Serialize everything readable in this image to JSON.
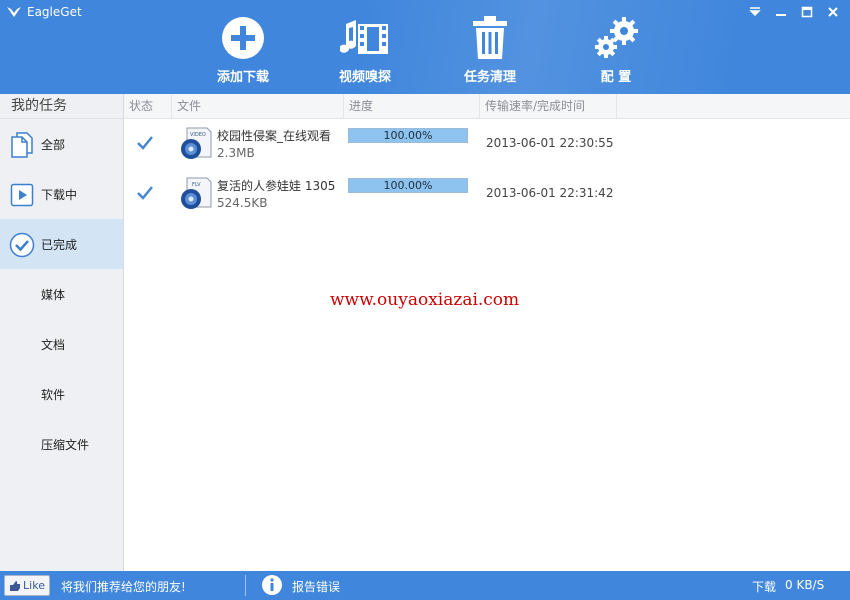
{
  "app": {
    "title": "EagleGet"
  },
  "window_controls": {
    "menu": "▾",
    "minimize": "—",
    "maximize": "☐",
    "close": "✕"
  },
  "toolbar": [
    {
      "id": "add",
      "label": "添加下载",
      "icon": "add-circle-icon"
    },
    {
      "id": "sniff",
      "label": "视频嗅探",
      "icon": "video-film-icon"
    },
    {
      "id": "clean",
      "label": "任务清理",
      "icon": "trash-icon"
    },
    {
      "id": "settings",
      "label": "配 置",
      "icon": "gears-icon"
    }
  ],
  "sidebar": {
    "header": "我的任务",
    "items": [
      {
        "label": "全部",
        "icon": "documents-icon",
        "active": false
      },
      {
        "label": "下载中",
        "icon": "play-icon",
        "active": false
      },
      {
        "label": "已完成",
        "icon": "check-circle-icon",
        "active": true
      },
      {
        "label": "媒体",
        "active": false
      },
      {
        "label": "文档",
        "active": false
      },
      {
        "label": "软件",
        "active": false
      },
      {
        "label": "压缩文件",
        "active": false
      }
    ]
  },
  "columns": [
    "状态",
    "文件",
    "进度",
    "传输速率/完成时间"
  ],
  "rows": [
    {
      "name": "校园性侵案_在线观看",
      "size": "2.3MB",
      "progress_text": "100.00%",
      "progress": 1.0,
      "time": "2013-06-01 22:30:55",
      "file_type": "VIDEO"
    },
    {
      "name": "复活的人参娃娃 1305",
      "size": "524.5KB",
      "progress_text": "100.00%",
      "progress": 1.0,
      "time": "2013-06-01 22:31:42",
      "file_type": "FLV"
    }
  ],
  "watermark": "www.ouyaoxiazai.com",
  "footer": {
    "like": "Like",
    "recommend": "将我们推荐给您的朋友!",
    "report": "报告错误",
    "speed_label": "下载",
    "speed_value": "0 KB/S"
  },
  "colors": {
    "brand_blue": "#3f86dc",
    "sidebar_bg": "#eef0f3",
    "active_item": "#d3e4f5",
    "progress_fill": "#8dc3ee",
    "watermark": "#cc0000"
  }
}
